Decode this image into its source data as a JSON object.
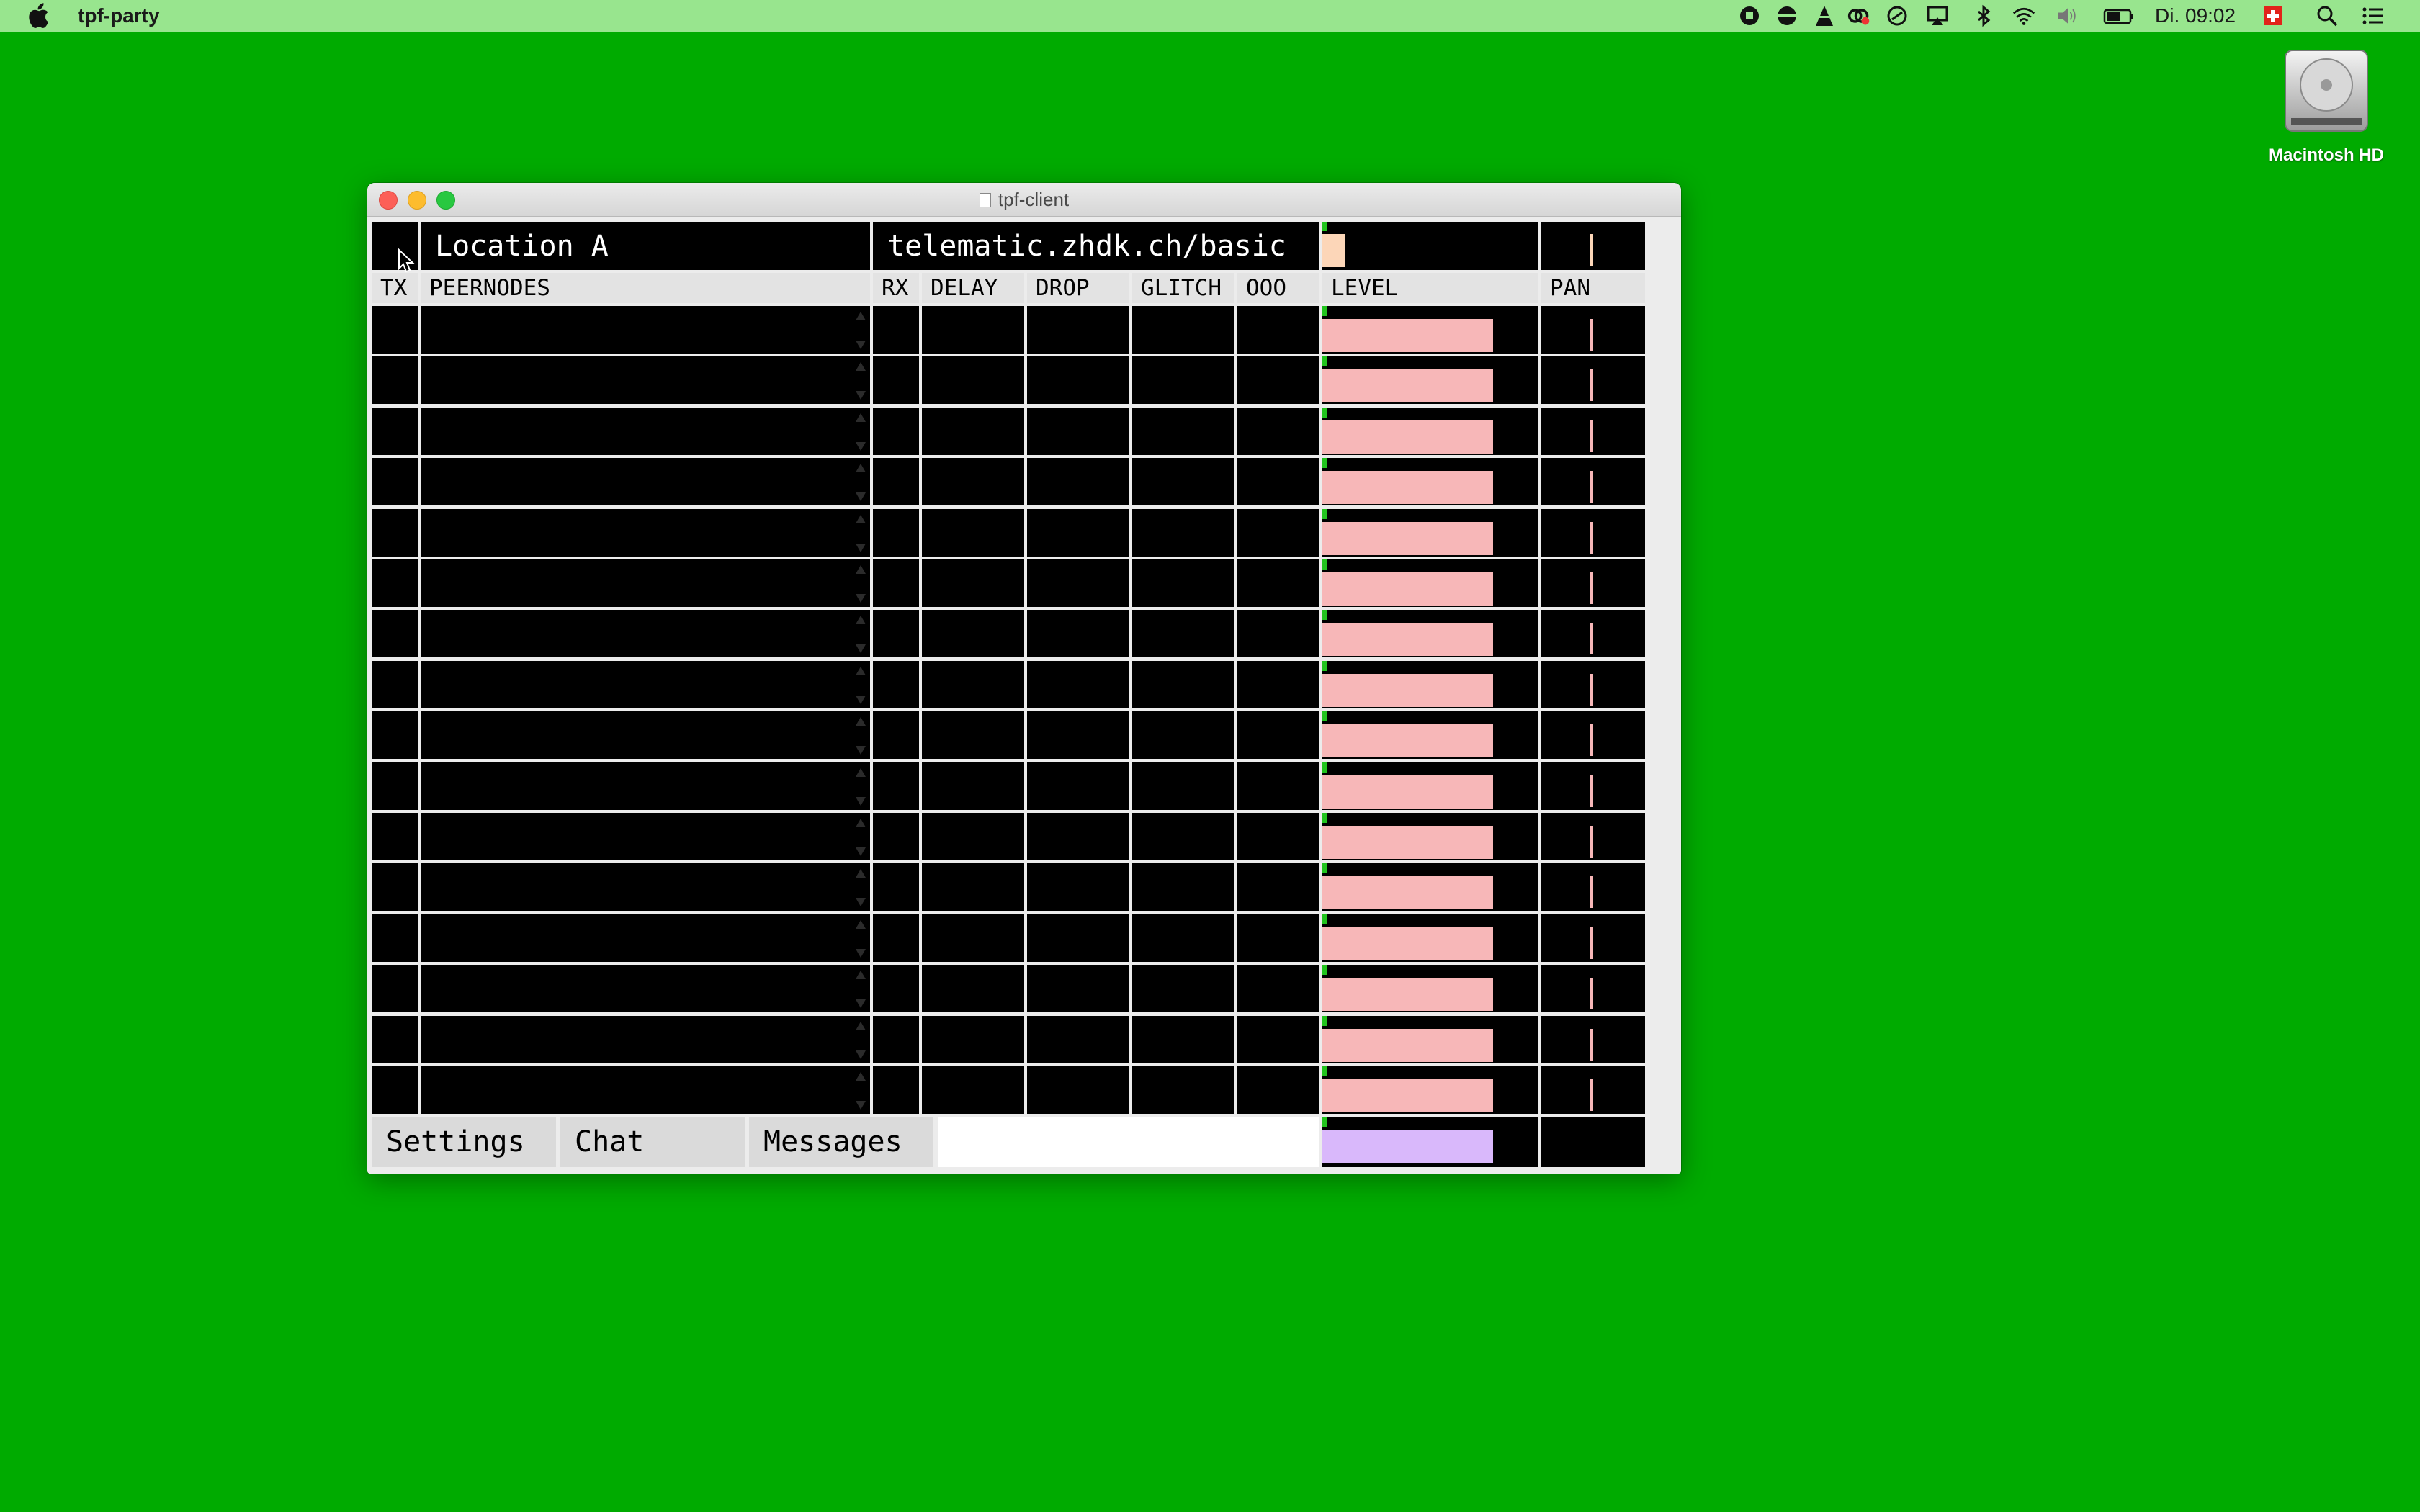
{
  "menubar": {
    "app_name": "tpf-party",
    "clock": "Di. 09:02",
    "status_icons": [
      "record-icon",
      "cloud-icon",
      "vlc-icon",
      "creative-cloud-icon",
      "sync-icon",
      "airplay-icon",
      "bluetooth-icon",
      "wifi-icon",
      "volume-icon",
      "battery-icon",
      "swiss-flag-icon",
      "spotlight-search-icon",
      "notification-center-icon"
    ]
  },
  "desktop": {
    "drive_label": "Macintosh HD"
  },
  "window": {
    "title": "tpf-client",
    "location": "Location A",
    "server": "telematic.zhdk.ch/basic",
    "columns": {
      "tx": "TX",
      "peernodes": "PEERNODES",
      "rx": "RX",
      "delay": "DELAY",
      "drop": "DROP",
      "glitch": "GLITCH",
      "ooo": "OOO",
      "level": "LEVEL",
      "pan": "PAN"
    },
    "track_count": 16,
    "track_level_fraction": 0.79,
    "master_level_fraction": 0.79,
    "tabs": {
      "settings": "Settings",
      "chat": "Chat",
      "messages": "Messages"
    },
    "colors": {
      "level_bar": "#f7b7b8",
      "master_level_bar": "#d9b8fb",
      "level_indicator": "#22c41e",
      "top_level_bar": "#fcd6b8"
    }
  }
}
